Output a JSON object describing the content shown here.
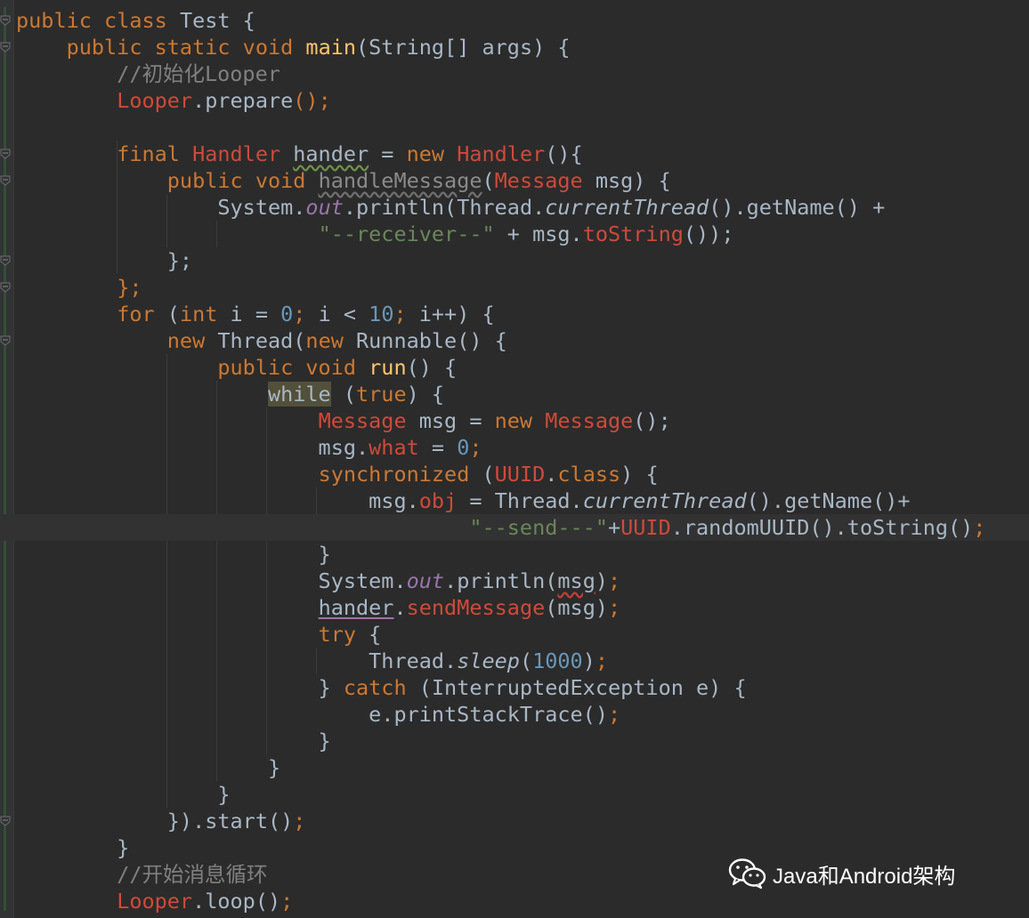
{
  "editor": {
    "lines": [
      {
        "tokens": [
          [
            "kw",
            "public "
          ],
          [
            "kw",
            "class "
          ],
          [
            "p",
            "Test {"
          ]
        ]
      },
      {
        "tokens": [
          [
            "p",
            "    "
          ],
          [
            "kw",
            "public static void "
          ],
          [
            "method",
            "main"
          ],
          [
            "p",
            "(String[] args) {"
          ]
        ]
      },
      {
        "tokens": [
          [
            "p",
            "        "
          ],
          [
            "comment",
            "//初始化Looper"
          ]
        ]
      },
      {
        "tokens": [
          [
            "p",
            "        "
          ],
          [
            "cls",
            "Looper"
          ],
          [
            "p",
            "."
          ],
          [
            "p",
            "prepare"
          ],
          [
            "kw",
            "();"
          ]
        ]
      },
      {
        "tokens": []
      },
      {
        "tokens": [
          [
            "p",
            "        "
          ],
          [
            "kw",
            "final "
          ],
          [
            "cls",
            "Handler "
          ],
          [
            "warn",
            "hander"
          ],
          [
            "p",
            " = "
          ],
          [
            "kw",
            "new "
          ],
          [
            "cls",
            "Handler"
          ],
          [
            "p",
            "(){"
          ]
        ]
      },
      {
        "tokens": [
          [
            "p",
            "            "
          ],
          [
            "kw",
            "public void "
          ],
          [
            "unused",
            "handleMessage"
          ],
          [
            "p",
            "("
          ],
          [
            "cls",
            "Message"
          ],
          [
            "p",
            " msg) {"
          ]
        ]
      },
      {
        "tokens": [
          [
            "p",
            "                System."
          ],
          [
            "field",
            "out"
          ],
          [
            "p",
            ".println(Thread."
          ],
          [
            "ital",
            "currentThread"
          ],
          [
            "p",
            "().getName() +"
          ]
        ]
      },
      {
        "tokens": [
          [
            "p",
            "                        "
          ],
          [
            "str",
            "\"--receiver--\""
          ],
          [
            "p",
            " + msg."
          ],
          [
            "field-red",
            "toString"
          ],
          [
            "p",
            "());"
          ]
        ]
      },
      {
        "tokens": [
          [
            "p",
            "            };"
          ]
        ]
      },
      {
        "tokens": [
          [
            "p",
            "        "
          ],
          [
            "kw",
            "};"
          ]
        ]
      },
      {
        "tokens": [
          [
            "p",
            "        "
          ],
          [
            "kw",
            "for "
          ],
          [
            "p",
            "("
          ],
          [
            "kw",
            "int "
          ],
          [
            "p",
            "i = "
          ],
          [
            "num",
            "0"
          ],
          [
            "kw",
            "; "
          ],
          [
            "p",
            "i < "
          ],
          [
            "num",
            "10"
          ],
          [
            "kw",
            "; "
          ],
          [
            "p",
            "i++) {"
          ]
        ]
      },
      {
        "tokens": [
          [
            "p",
            "            "
          ],
          [
            "kw",
            "new "
          ],
          [
            "p",
            "Thread("
          ],
          [
            "kw",
            "new "
          ],
          [
            "p",
            "Runnable() {"
          ]
        ]
      },
      {
        "tokens": [
          [
            "p",
            "                "
          ],
          [
            "kw",
            "public void "
          ],
          [
            "method",
            "run"
          ],
          [
            "p",
            "() {"
          ]
        ]
      },
      {
        "tokens": [
          [
            "p",
            "                    "
          ],
          [
            "hl",
            "while"
          ],
          [
            "p",
            " ("
          ],
          [
            "kw",
            "true"
          ],
          [
            "p",
            ") {"
          ]
        ]
      },
      {
        "tokens": [
          [
            "p",
            "                        "
          ],
          [
            "cls",
            "Message "
          ],
          [
            "p",
            "msg = "
          ],
          [
            "kw",
            "new "
          ],
          [
            "cls",
            "Message"
          ],
          [
            "p",
            "();"
          ]
        ]
      },
      {
        "tokens": [
          [
            "p",
            "                        msg."
          ],
          [
            "field-red",
            "what"
          ],
          [
            "p",
            " = "
          ],
          [
            "num",
            "0"
          ],
          [
            "kw",
            ";"
          ]
        ]
      },
      {
        "tokens": [
          [
            "p",
            "                        "
          ],
          [
            "kw",
            "synchronized "
          ],
          [
            "p",
            "("
          ],
          [
            "cls",
            "UUID"
          ],
          [
            "p",
            "."
          ],
          [
            "kw",
            "class"
          ],
          [
            "p",
            ") {"
          ]
        ]
      },
      {
        "tokens": [
          [
            "p",
            "                            msg."
          ],
          [
            "field-red",
            "obj"
          ],
          [
            "p",
            " = Thread."
          ],
          [
            "ital",
            "currentThread"
          ],
          [
            "p",
            "().getName()+"
          ]
        ]
      },
      {
        "tokens": [
          [
            "p",
            "                                    "
          ],
          [
            "str",
            "\"--send---\""
          ],
          [
            "p",
            "+"
          ],
          [
            "cls",
            "UUID"
          ],
          [
            "p",
            ".randomUUID().toString()"
          ],
          [
            "kw",
            ";"
          ]
        ],
        "current": true
      },
      {
        "tokens": [
          [
            "p",
            "                        }"
          ]
        ]
      },
      {
        "tokens": [
          [
            "p",
            "                        System."
          ],
          [
            "field",
            "out"
          ],
          [
            "p",
            ".println("
          ],
          [
            "err",
            "msg"
          ],
          [
            "p",
            ")"
          ],
          [
            "kw",
            ";"
          ]
        ]
      },
      {
        "tokens": [
          [
            "p",
            "                        "
          ],
          [
            "purple",
            "hander"
          ],
          [
            "p",
            "."
          ],
          [
            "field-red",
            "sendMessage"
          ],
          [
            "p",
            "(msg)"
          ],
          [
            "kw",
            ";"
          ]
        ]
      },
      {
        "tokens": [
          [
            "p",
            "                        "
          ],
          [
            "kw",
            "try "
          ],
          [
            "p",
            "{"
          ]
        ]
      },
      {
        "tokens": [
          [
            "p",
            "                            Thread."
          ],
          [
            "ital",
            "sleep"
          ],
          [
            "p",
            "("
          ],
          [
            "num",
            "1000"
          ],
          [
            "p",
            ")"
          ],
          [
            "kw",
            ";"
          ]
        ]
      },
      {
        "tokens": [
          [
            "p",
            "                        } "
          ],
          [
            "kw",
            "catch "
          ],
          [
            "p",
            "(InterruptedException e) {"
          ]
        ]
      },
      {
        "tokens": [
          [
            "p",
            "                            e.printStackTrace()"
          ],
          [
            "kw",
            ";"
          ]
        ]
      },
      {
        "tokens": [
          [
            "p",
            "                        }"
          ]
        ]
      },
      {
        "tokens": [
          [
            "p",
            "                    }"
          ]
        ]
      },
      {
        "tokens": [
          [
            "p",
            "                }"
          ]
        ]
      },
      {
        "tokens": [
          [
            "p",
            "            }).start()"
          ],
          [
            "kw",
            ";"
          ]
        ]
      },
      {
        "tokens": [
          [
            "p",
            "        }"
          ]
        ]
      },
      {
        "tokens": [
          [
            "p",
            "        "
          ],
          [
            "comment",
            "//开始消息循环"
          ]
        ]
      },
      {
        "tokens": [
          [
            "p",
            "        "
          ],
          [
            "cls",
            "Looper"
          ],
          [
            "p",
            ".loop()"
          ],
          [
            "kw",
            ";"
          ]
        ]
      }
    ]
  },
  "watermark": {
    "text": "Java和Android架构",
    "icon": "wechat-icon"
  },
  "colors": {
    "background": "#2b2b2b",
    "keyword": "#cc7832",
    "class": "#cf4a3a",
    "method": "#ffc66d",
    "number": "#6897bb",
    "string": "#6a8759",
    "comment": "#808080",
    "field": "#9876aa",
    "plain": "#a9b7c6"
  }
}
